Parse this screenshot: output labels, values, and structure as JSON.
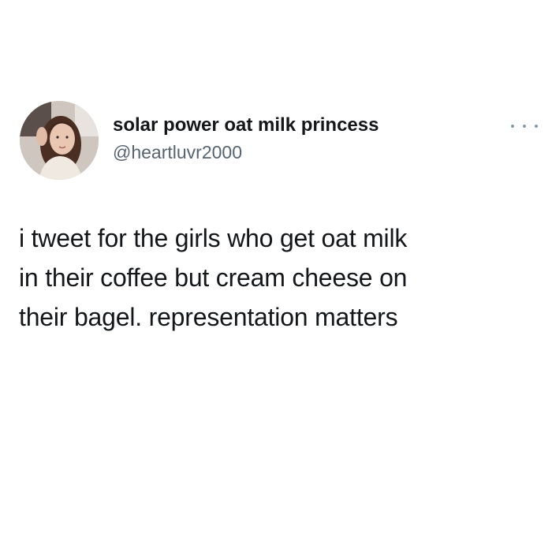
{
  "tweet": {
    "author": {
      "display_name": "solar power oat milk princess",
      "handle": "@heartluvr2000",
      "avatar_icon": "profile-photo-avatar"
    },
    "more_icon": "more-options-dots-icon",
    "text_lines": [
      "i tweet for the girls who get oat milk",
      "in their coffee but cream cheese on",
      "their bagel. representation matters"
    ]
  },
  "colors": {
    "background": "#ffffff",
    "text_primary": "#14171a",
    "text_secondary": "#566370",
    "icon_gray": "#8899a6"
  }
}
